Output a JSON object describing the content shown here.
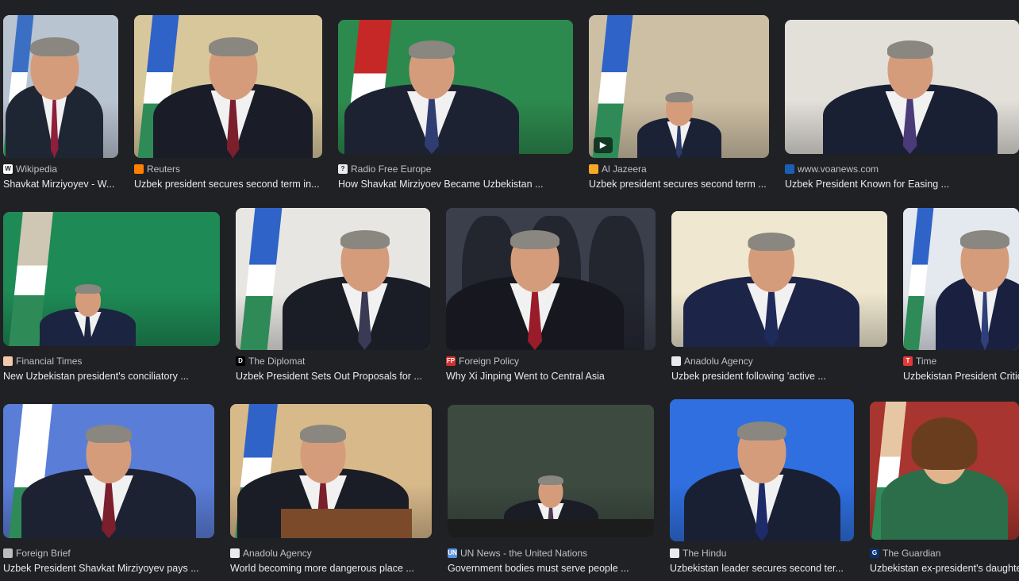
{
  "results": [
    {
      "source": "Wikipedia",
      "title": "Shavkat Mirziyoyev - W...",
      "favicon": "wikipedia-icon",
      "fav_color": "#ffffff",
      "fav_text_color": "#202124",
      "fav_glyph": "W",
      "bg": "#b9c4d1",
      "flag": "#3a6fc4",
      "suit": "#1f2633",
      "tie": "#8e1e3a"
    },
    {
      "source": "Reuters",
      "title": "Uzbek president secures second term in...",
      "favicon": "reuters-icon",
      "fav_color": "#ff8000",
      "fav_text_color": "#ffffff",
      "fav_glyph": "",
      "bg": "#d9c79c",
      "flag": "#2f63c8",
      "suit": "#1a1d28",
      "tie": "#7c1f2c"
    },
    {
      "source": "Radio Free Europe",
      "title": "How Shavkat Mirziyoev Became Uzbekistan ...",
      "favicon": "rfe-icon",
      "fav_color": "#e8eaed",
      "fav_text_color": "#202124",
      "fav_glyph": "?",
      "bg": "#2d8a4e",
      "flag": "#c62828",
      "suit": "#1d2233",
      "tie": "#2f3d72"
    },
    {
      "source": "Al Jazeera",
      "title": "Uzbek president secures second term ...",
      "favicon": "aljazeera-icon",
      "fav_color": "#f9a825",
      "fav_text_color": "#ffffff",
      "fav_glyph": "",
      "bg": "#cdbfa4",
      "flag": "#2f63c8",
      "suit": "#1b2236",
      "tie": "#2c3a6a"
    },
    {
      "source": "www.voanews.com",
      "title": "Uzbek President Known for Easing ...",
      "favicon": "voa-icon",
      "fav_color": "#1a5fb4",
      "fav_text_color": "#ffffff",
      "fav_glyph": "",
      "bg": "#e3e0da",
      "flag": "#e3e0da",
      "suit": "#1a2033",
      "tie": "#4a3a78"
    },
    {
      "source": "Financial Times",
      "title": "New Uzbekistan president's conciliatory ...",
      "favicon": "ft-icon",
      "fav_color": "#f2c9a9",
      "fav_text_color": "#202124",
      "fav_glyph": "",
      "bg": "#1e8a55",
      "flag": "#cfc6b4",
      "suit": "#1b2440",
      "tie": "#1b2440"
    },
    {
      "source": "The Diplomat",
      "title": "Uzbek President Sets Out Proposals for ...",
      "favicon": "diplomat-icon",
      "fav_color": "#000000",
      "fav_text_color": "#ffffff",
      "fav_glyph": "D",
      "bg": "#e8e6e2",
      "flag": "#2f63c8",
      "suit": "#1a1c26",
      "tie": "#3a3a55"
    },
    {
      "source": "Foreign Policy",
      "title": "Why Xi Jinping Went to Central Asia",
      "favicon": "foreignpolicy-icon",
      "fav_color": "#d32f2f",
      "fav_text_color": "#ffffff",
      "fav_glyph": "FP",
      "bg": "#3b3f4c",
      "flag": "#3b3f4c",
      "suit": "#17181f",
      "tie": "#9a1c2a"
    },
    {
      "source": "Anadolu Agency",
      "title": "Uzbek president following 'active ...",
      "favicon": "anadolu-icon",
      "fav_color": "#e8eaed",
      "fav_text_color": "#202124",
      "fav_glyph": "",
      "bg": "#efe7cf",
      "flag": "#efe7cf",
      "suit": "#1c2448",
      "tie": "#1e2a5a"
    },
    {
      "source": "Time",
      "title": "Uzbekistan President Critic...",
      "favicon": "time-icon",
      "fav_color": "#e53935",
      "fav_text_color": "#ffffff",
      "fav_glyph": "T",
      "bg": "#e4e8ef",
      "flag": "#2f63c8",
      "suit": "#1a2140",
      "tie": "#2f3f7a"
    },
    {
      "source": "Foreign Brief",
      "title": "Uzbek President Shavkat Mirziyoyev pays ...",
      "favicon": "foreignbrief-icon",
      "fav_color": "#bdbdbd",
      "fav_text_color": "#202124",
      "fav_glyph": "",
      "bg": "#5a7dd8",
      "flag": "#ffffff",
      "suit": "#1d2233",
      "tie": "#7c1f2c"
    },
    {
      "source": "Anadolu Agency",
      "title": "World becoming more dangerous place ...",
      "favicon": "anadolu-icon",
      "fav_color": "#e8eaed",
      "fav_text_color": "#202124",
      "fav_glyph": "",
      "bg": "#d8b98a",
      "flag": "#2f63c8",
      "suit": "#1a1c26",
      "tie": "#7c1f2c"
    },
    {
      "source": "UN News - the United Nations",
      "title": "Government bodies must serve people ...",
      "favicon": "un-icon",
      "fav_color": "#5b92e5",
      "fav_text_color": "#ffffff",
      "fav_glyph": "UN",
      "bg": "#3c4a40",
      "flag": "#3c4a40",
      "suit": "#1a1c26",
      "tie": "#4a3a55"
    },
    {
      "source": "The Hindu",
      "title": "Uzbekistan leader secures second ter...",
      "favicon": "hindu-icon",
      "fav_color": "#e8eaed",
      "fav_text_color": "#202124",
      "fav_glyph": "",
      "bg": "#2f6fe0",
      "flag": "#2f6fe0",
      "suit": "#1a2034",
      "tie": "#1e2a6a"
    },
    {
      "source": "The Guardian",
      "title": "Uzbekistan ex-president's daughter...",
      "favicon": "guardian-icon",
      "fav_color": "#0c2f6b",
      "fav_text_color": "#ffffff",
      "fav_glyph": "G",
      "bg": "#a8352f",
      "flag": "#e7c7a3",
      "suit": "#2c6e4a",
      "tie": "#2c6e4a"
    }
  ]
}
